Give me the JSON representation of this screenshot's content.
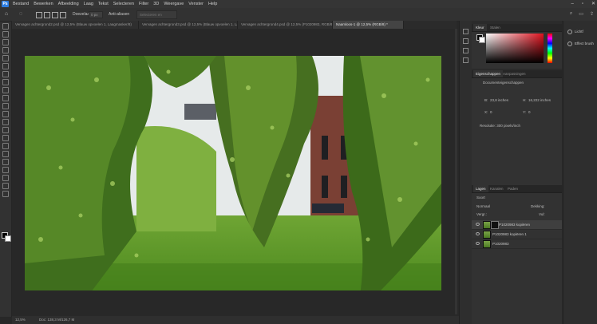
{
  "app": {
    "logo": "Ps"
  },
  "menu": [
    "Bestand",
    "Bewerken",
    "Afbeelding",
    "Laag",
    "Tekst",
    "Selecteren",
    "Filter",
    "3D",
    "Weergave",
    "Venster",
    "Help"
  ],
  "window_controls": [
    "–",
    "▫",
    "✕"
  ],
  "options": {
    "doezelaar_label": "Doezelaar:",
    "doezelaar_value": "0 px",
    "anti_alias_label": "Anti-aliasen",
    "search_placeholder": "Selecteren en maskeren..."
  },
  "tabs": [
    {
      "label": "Vervagen achtergrond2.psd @ 12,5% (Blauw opvoelen 1, Laagmasker/8)",
      "active": false
    },
    {
      "label": "Vervagen achtergrond3.psd @ 12,5% (Blauw opvoelen 1, Laagmasker/8)",
      "active": false
    },
    {
      "label": "Vervagen achtergrond4.psd @ 12,5% (P1020983, RGB/8)",
      "active": false
    },
    {
      "label": "Naamloos-1 @ 12,5% (RGB/8) *",
      "active": true
    }
  ],
  "status": {
    "zoom": "12,5%",
    "doc": "Doc: 138,3 M/126,7 M"
  },
  "color_panel": {
    "tabs": [
      "Kleur",
      "Stalen"
    ]
  },
  "properties_panel": {
    "tabs": [
      "Eigenschappen",
      "Aanpassingen"
    ],
    "doc_label": "Documenteigenschappen",
    "w_label": "B:",
    "w_value": "23,8 inches",
    "h_label": "H:",
    "h_value": "16,222 inches",
    "x_label": "X:",
    "x_value": "0",
    "y_label": "Y:",
    "y_value": "0",
    "resolution": "Resolutie: 300 pixels/inch"
  },
  "layers_panel": {
    "tabs": [
      "Lagen",
      "Kanalen",
      "Paden"
    ],
    "kind_filter": "Soort",
    "blend_mode": "Normaal",
    "opacity_label": "Dekking:",
    "lock_label": "Vergr.:",
    "fill_label": "Vul:",
    "layers": [
      {
        "name": "P1020983 kopiëren",
        "selected": true
      },
      {
        "name": "P1020983 kopiëren 1",
        "selected": false
      },
      {
        "name": "P1020983",
        "selected": false
      }
    ]
  },
  "libraries_panel": {
    "items": [
      "Lichtf",
      "Effect brush"
    ]
  },
  "colors": {
    "accent": "#2d7de0",
    "bg": "#282828"
  }
}
